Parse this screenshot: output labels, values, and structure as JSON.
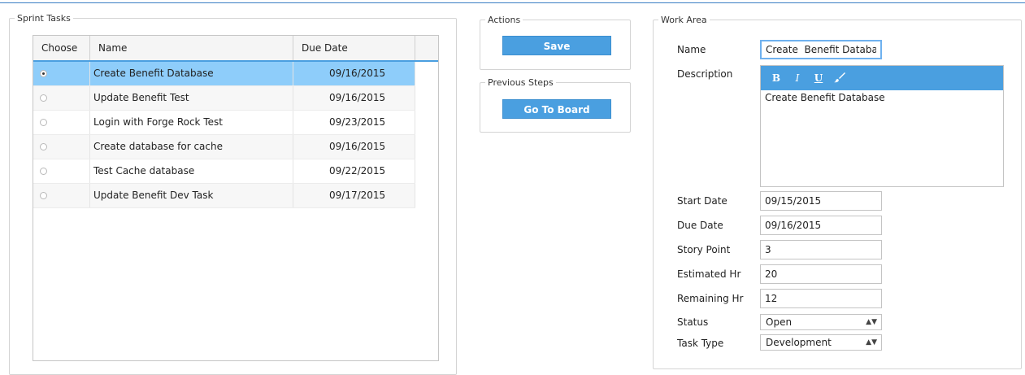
{
  "sprint_tasks": {
    "legend": "Sprint Tasks",
    "columns": [
      "Choose",
      "Name",
      "Due Date"
    ],
    "rows": [
      {
        "name": "Create Benefit Database",
        "due": "09/16/2015",
        "selected": true
      },
      {
        "name": "Update Benefit Test",
        "due": "09/16/2015",
        "selected": false
      },
      {
        "name": "Login with Forge Rock Test",
        "due": "09/23/2015",
        "selected": false
      },
      {
        "name": "Create database for cache",
        "due": "09/16/2015",
        "selected": false
      },
      {
        "name": "Test Cache database",
        "due": "09/22/2015",
        "selected": false
      },
      {
        "name": "Update Benefit Dev Task",
        "due": "09/17/2015",
        "selected": false
      }
    ]
  },
  "actions": {
    "legend": "Actions",
    "save_label": "Save"
  },
  "previous_steps": {
    "legend": "Previous Steps",
    "board_label": "Go To Board"
  },
  "work_area": {
    "legend": "Work Area",
    "name_label": "Name",
    "name_value": "Create  Benefit Database",
    "description_label": "Description",
    "description_value": "Create  Benefit Database",
    "toolbar": {
      "bold": "B",
      "italic": "I",
      "underline": "U",
      "brush": "🖌"
    },
    "start_date_label": "Start Date",
    "start_date_value": "09/15/2015",
    "due_date_label": "Due Date",
    "due_date_value": "09/16/2015",
    "story_point_label": "Story Point",
    "story_point_value": "3",
    "estimated_label": "Estimated Hr",
    "estimated_value": "20",
    "remaining_label": "Remaining Hr",
    "remaining_value": "12",
    "status_label": "Status",
    "status_value": "Open",
    "task_type_label": "Task Type",
    "task_type_value": "Development"
  },
  "colors": {
    "accent": "#4a9fe0",
    "selected_row": "#8ecdfa"
  }
}
